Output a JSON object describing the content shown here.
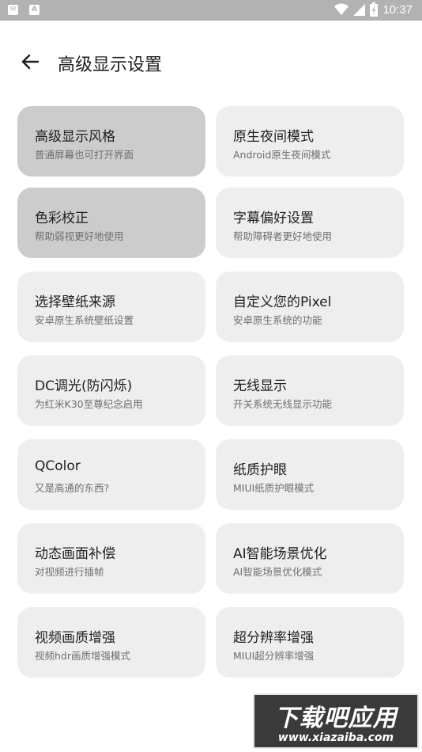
{
  "status_bar": {
    "time": "10:37",
    "left_icons": [
      "notification-icon",
      "font-icon"
    ],
    "left_icon_glyphs": [
      "✉",
      "A"
    ],
    "right_icons": [
      "wifi-icon",
      "signal-icon",
      "battery-icon"
    ]
  },
  "header": {
    "title": "高级显示设置",
    "back_icon": "arrow-left-icon"
  },
  "cards": [
    {
      "title": "高级显示风格",
      "subtitle": "普通屏幕也可打开界面",
      "selected": true
    },
    {
      "title": "原生夜间模式",
      "subtitle": "Android原生夜间模式",
      "selected": false
    },
    {
      "title": "色彩校正",
      "subtitle": "帮助弱视更好地使用",
      "selected": true
    },
    {
      "title": "字幕偏好设置",
      "subtitle": "帮助障碍者更好地使用",
      "selected": false
    },
    {
      "title": "选择壁纸来源",
      "subtitle": "安卓原生系统壁纸设置",
      "selected": false
    },
    {
      "title": "自定义您的Pixel",
      "subtitle": "安卓原生系统的功能",
      "selected": false
    },
    {
      "title": "DC调光(防闪烁)",
      "subtitle": "为红米K30至尊纪念启用",
      "selected": false
    },
    {
      "title": "无线显示",
      "subtitle": "开关系统无线显示功能",
      "selected": false
    },
    {
      "title": "QColor",
      "subtitle": "又是高通的东西?",
      "selected": false
    },
    {
      "title": "纸质护眼",
      "subtitle": "MIUI纸质护眼模式",
      "selected": false
    },
    {
      "title": "动态画面补偿",
      "subtitle": "对视频进行插帧",
      "selected": false
    },
    {
      "title": "AI智能场景优化",
      "subtitle": "AI智能场景优化模式",
      "selected": false
    },
    {
      "title": "视频画质增强",
      "subtitle": "视频hdr画质增强模式",
      "selected": false
    },
    {
      "title": "超分辨率增强",
      "subtitle": "MIUI超分辨率增强",
      "selected": false
    }
  ],
  "watermark": {
    "line1": "下载吧应用",
    "line2": "www.xiazaiba.com"
  },
  "colors": {
    "card_bg": "#eeeeee",
    "card_selected_bg": "#cccccc",
    "status_bar": "#b2b2b2"
  }
}
